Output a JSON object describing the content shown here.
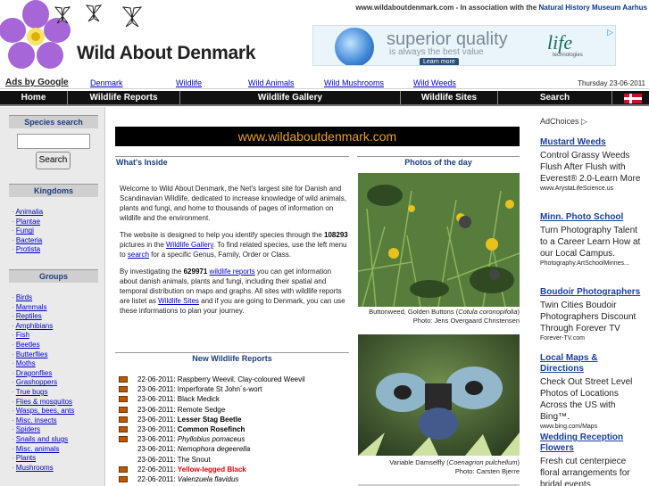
{
  "header": {
    "site_title": "Wild About Denmark",
    "top_domain": "www.wildaboutdenmark.com",
    "top_sep": " - In association with the ",
    "top_partner": "Natural History Museum Aarhus",
    "banner": {
      "headline": "superior quality",
      "tagline": "is always the best value",
      "cta": "Learn more",
      "brand": "life",
      "brand_sub": "technologies"
    }
  },
  "ads_row": {
    "label": "Ads by Google",
    "links": [
      "Denmark",
      "Wildlife",
      "Wild Animals",
      "Wild Mushrooms",
      "Wild Weeds"
    ],
    "date": "Thursday 23-06-2011"
  },
  "nav": [
    "Home",
    "Wildlife Reports",
    "Wildlife Gallery",
    "Wildlife Sites",
    "Search"
  ],
  "left": {
    "search_title": "Species search",
    "search_button": "Search",
    "kingdoms_title": "Kingdoms",
    "kingdoms": [
      "Animalia",
      "Plantae",
      "Fungi",
      "Bacteria",
      "Protista"
    ],
    "groups_title": "Groups",
    "groups": [
      "Birds",
      "Mammals",
      "Reptiles",
      "Amphibians",
      "Fish",
      "Beetles",
      "Butterflies",
      "Moths",
      "Dragonflies",
      "Grashoppers",
      "True bugs",
      "Flies & mosquitos",
      "Wasps, bees, ants",
      "Misc. insects",
      "Spiders",
      "Snails and slugs",
      "Misc. animals",
      "Plants",
      "Mushrooms"
    ]
  },
  "main": {
    "url": "www.wildaboutdenmark.com",
    "whats_inside": "What's Inside",
    "photos_title": "Photos of the day",
    "intro": {
      "p1": "Welcome to Wild About Denmark, the Net's largest site for Danish and Scandinavian Wildlife, dedicated to increase knowledge of wild animals, plants and fungi, and home to thousands of pages of information on wildlife and the environment.",
      "p2a": "The website is designed to help you identify species through the ",
      "p2_count": "108293",
      "p2b": " pictures in the ",
      "p2_link": "Wildlife Gallery",
      "p2c": ". To find related species, use the left menu to ",
      "p2_link2": "search",
      "p2d": " for a specific Genus, Family, Order or Class.",
      "p3a": "By investigating the ",
      "p3_count": "629971",
      "p3_space": " ",
      "p3_link": "wildlife reports",
      "p3b": " you can get information about danish animals, plants and fungi, including their spatial and temporal distribution on maps and graphs. All sites with wildlife reports are listet as ",
      "p3_link2": "Wildlife Sites",
      "p3c": " and if you are going to Denmark, you can use these informations to plan your journey."
    },
    "photo1": {
      "caption_a": "Buttonweed, Golden Buttons (",
      "caption_sci": "Cotula coronopifolia",
      "caption_b": ")",
      "credit": "Photo: Jens Overgaard Christensen"
    },
    "photo2": {
      "caption_a": "Variable Damselfly (",
      "caption_sci": "Coenagrion pulchellum",
      "caption_b": ")",
      "credit": "Photo: Carsten Bjerre"
    },
    "reports_title": "New Wildlife Reports",
    "reports": [
      {
        "date": "22-06-2011:",
        "name": "Raspberry Weevil, Clay-coloured Weevil",
        "icon": true,
        "style": "normal"
      },
      {
        "date": "23-06-2011:",
        "name": "Imperforate St John´s-wort",
        "icon": true,
        "style": "normal"
      },
      {
        "date": "23-06-2011:",
        "name": "Black Medick",
        "icon": true,
        "style": "normal"
      },
      {
        "date": "23-06-2011:",
        "name": "Remote Sedge",
        "icon": true,
        "style": "normal"
      },
      {
        "date": "23-06-2011:",
        "name": "Lesser Stag Beetle",
        "icon": true,
        "style": "bold"
      },
      {
        "date": "23-06-2011:",
        "name": "Common Rosefinch",
        "icon": true,
        "style": "bold"
      },
      {
        "date": "23-06-2011:",
        "name": "Phyllobius pomaceus",
        "icon": true,
        "style": "italic"
      },
      {
        "date": "23-06-2011:",
        "name": "Nemophora degeerella",
        "icon": false,
        "style": "italic"
      },
      {
        "date": "23-06-2011:",
        "name": "The Snout",
        "icon": false,
        "style": "normal"
      },
      {
        "date": "22-06-2011:",
        "name": "Yellow-legged Black",
        "icon": true,
        "style": "red"
      },
      {
        "date": "22-06-2011:",
        "name": "Valenzuela flavidus",
        "icon": true,
        "style": "italic"
      }
    ]
  },
  "right": {
    "adchoices": "AdChoices ▷",
    "ads": [
      {
        "title": "Mustard Weeds",
        "desc": "Control Grassy Weeds Flush After Flush with Everest® 2.0-Learn More",
        "url": "www.ArystaLifeScience.us"
      },
      {
        "title": "Minn. Photo School",
        "desc": "Turn Photography Talent to a Career Learn How at our Local Campus.",
        "url": "Photography.ArtSchoolMinnes..."
      },
      {
        "title": "Boudoir Photographers",
        "desc": "Twin Cities Boudoir Photographers Discount Through Forever TV",
        "url": "Forever-TV.com"
      },
      {
        "title": "Local Maps & Directions",
        "desc": "Check Out Street Level Photos of Locations Across the US with Bing™.",
        "url": "www.bing.com/Maps"
      },
      {
        "title": "Wedding Reception Flowers",
        "desc": "Fresh cut centerpiece floral arrangements for bridal events",
        "url": ""
      }
    ]
  },
  "colors": {
    "nav_bg": "#111111",
    "head_text": "#1c3e7a",
    "url_text": "#e8a020",
    "link": "#0000cc"
  }
}
